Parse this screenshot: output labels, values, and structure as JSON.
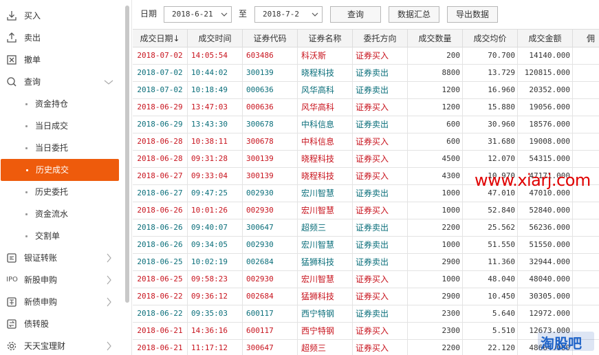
{
  "sidebar": {
    "items": [
      {
        "label": "买入",
        "icon": "download-icon"
      },
      {
        "label": "卖出",
        "icon": "upload-icon"
      },
      {
        "label": "撤单",
        "icon": "cancel-box-icon"
      },
      {
        "label": "查询",
        "icon": "search-icon"
      }
    ],
    "query_subitems": [
      {
        "label": "资金持仓"
      },
      {
        "label": "当日成交"
      },
      {
        "label": "当日委托"
      },
      {
        "label": "历史成交",
        "active": true
      },
      {
        "label": "历史委托"
      },
      {
        "label": "资金流水"
      },
      {
        "label": "交割单"
      }
    ],
    "bottom_items": [
      {
        "label": "银证转账",
        "icon": "bank-transfer-icon"
      },
      {
        "label": "新股申购",
        "icon": "ipo-icon",
        "icon_text": "IPO"
      },
      {
        "label": "新债申购",
        "icon": "bond-icon"
      },
      {
        "label": "债转股",
        "icon": "convert-icon"
      },
      {
        "label": "天天宝理财",
        "icon": "gear-icon"
      }
    ]
  },
  "toolbar": {
    "date_label": "日期",
    "start_date": "2018-6-21",
    "to_label": "至",
    "end_date": "2018-7-2",
    "query_button": "查询",
    "summary_button": "数据汇总",
    "export_button": "导出数据"
  },
  "table": {
    "headers": [
      "成交日期↓",
      "成交时间",
      "证券代码",
      "证券名称",
      "委托方向",
      "成交数量",
      "成交均价",
      "成交金额",
      "佣"
    ],
    "rows": [
      {
        "date": "2018-07-02",
        "time": "14:05:54",
        "code": "603486",
        "name": "科沃斯",
        "dir": "证券买入",
        "qty": "200",
        "price": "70.700",
        "amount": "14140.000",
        "side": "buy"
      },
      {
        "date": "2018-07-02",
        "time": "10:44:02",
        "code": "300139",
        "name": "晓程科技",
        "dir": "证券卖出",
        "qty": "8800",
        "price": "13.729",
        "amount": "120815.000",
        "side": "sell"
      },
      {
        "date": "2018-07-02",
        "time": "10:18:49",
        "code": "000636",
        "name": "风华高科",
        "dir": "证券卖出",
        "qty": "1200",
        "price": "16.960",
        "amount": "20352.000",
        "side": "sell"
      },
      {
        "date": "2018-06-29",
        "time": "13:47:03",
        "code": "000636",
        "name": "风华高科",
        "dir": "证券买入",
        "qty": "1200",
        "price": "15.880",
        "amount": "19056.000",
        "side": "buy"
      },
      {
        "date": "2018-06-29",
        "time": "13:43:30",
        "code": "300678",
        "name": "中科信息",
        "dir": "证券卖出",
        "qty": "600",
        "price": "30.960",
        "amount": "18576.000",
        "side": "sell"
      },
      {
        "date": "2018-06-28",
        "time": "10:38:11",
        "code": "300678",
        "name": "中科信息",
        "dir": "证券买入",
        "qty": "600",
        "price": "31.680",
        "amount": "19008.000",
        "side": "buy"
      },
      {
        "date": "2018-06-28",
        "time": "09:31:28",
        "code": "300139",
        "name": "晓程科技",
        "dir": "证券买入",
        "qty": "4500",
        "price": "12.070",
        "amount": "54315.000",
        "side": "buy"
      },
      {
        "date": "2018-06-27",
        "time": "09:33:04",
        "code": "300139",
        "name": "晓程科技",
        "dir": "证券买入",
        "qty": "4300",
        "price": "10.970",
        "amount": "47171.000",
        "side": "buy"
      },
      {
        "date": "2018-06-27",
        "time": "09:47:25",
        "code": "002930",
        "name": "宏川智慧",
        "dir": "证券卖出",
        "qty": "1000",
        "price": "47.010",
        "amount": "47010.000",
        "side": "sell"
      },
      {
        "date": "2018-06-26",
        "time": "10:01:26",
        "code": "002930",
        "name": "宏川智慧",
        "dir": "证券买入",
        "qty": "1000",
        "price": "52.840",
        "amount": "52840.000",
        "side": "buy"
      },
      {
        "date": "2018-06-26",
        "time": "09:40:07",
        "code": "300647",
        "name": "超频三",
        "dir": "证券卖出",
        "qty": "2200",
        "price": "25.562",
        "amount": "56236.000",
        "side": "sell"
      },
      {
        "date": "2018-06-26",
        "time": "09:34:05",
        "code": "002930",
        "name": "宏川智慧",
        "dir": "证券卖出",
        "qty": "1000",
        "price": "51.550",
        "amount": "51550.000",
        "side": "sell"
      },
      {
        "date": "2018-06-25",
        "time": "10:02:19",
        "code": "002684",
        "name": "猛狮科技",
        "dir": "证券卖出",
        "qty": "2900",
        "price": "11.360",
        "amount": "32944.000",
        "side": "sell"
      },
      {
        "date": "2018-06-25",
        "time": "09:58:23",
        "code": "002930",
        "name": "宏川智慧",
        "dir": "证券买入",
        "qty": "1000",
        "price": "48.040",
        "amount": "48040.000",
        "side": "buy"
      },
      {
        "date": "2018-06-22",
        "time": "09:36:12",
        "code": "002684",
        "name": "猛狮科技",
        "dir": "证券买入",
        "qty": "2900",
        "price": "10.450",
        "amount": "30305.000",
        "side": "buy"
      },
      {
        "date": "2018-06-22",
        "time": "09:35:03",
        "code": "600117",
        "name": "西宁特钢",
        "dir": "证券卖出",
        "qty": "2300",
        "price": "5.640",
        "amount": "12972.000",
        "side": "sell"
      },
      {
        "date": "2018-06-21",
        "time": "14:36:16",
        "code": "600117",
        "name": "西宁特钢",
        "dir": "证券买入",
        "qty": "2300",
        "price": "5.510",
        "amount": "12673.000",
        "side": "buy"
      },
      {
        "date": "2018-06-21",
        "time": "11:17:12",
        "code": "300647",
        "name": "超频三",
        "dir": "证券买入",
        "qty": "2200",
        "price": "22.120",
        "amount": "48664.000",
        "side": "buy"
      }
    ]
  },
  "watermarks": {
    "site": "www.xiarj.com",
    "brand": "淘股吧"
  },
  "colors": {
    "active": "#ee5b0c",
    "buy": "#c8141e",
    "sell": "#0a6e7a"
  }
}
